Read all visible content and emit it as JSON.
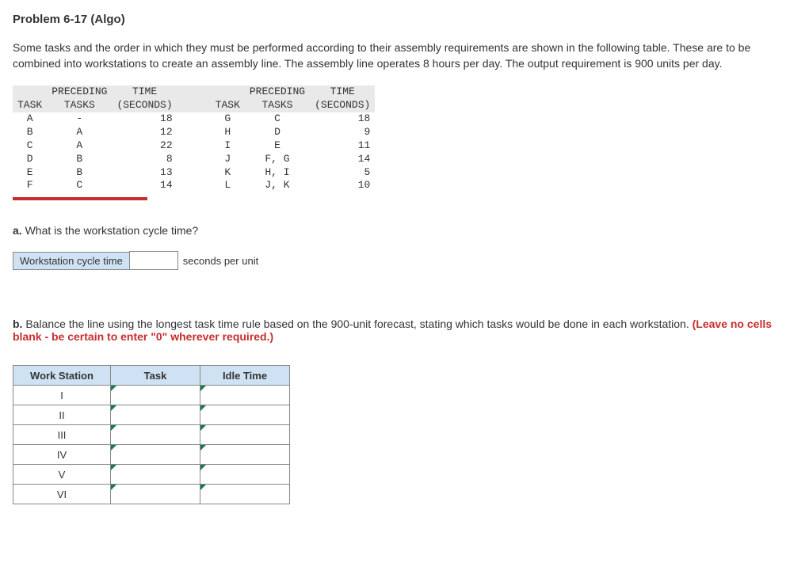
{
  "title": "Problem 6-17 (Algo)",
  "intro": "Some tasks and the order in which they must be performed according to their assembly requirements are shown in the following table. These are to be combined into workstations to create an assembly line. The assembly line operates 8 hours per day. The output requirement is 900 units per day.",
  "headers": {
    "task": "TASK",
    "preceding1": "PRECEDING",
    "preceding2": "TASKS",
    "time1": "TIME",
    "time2": "(SECONDS)"
  },
  "left_rows": [
    {
      "task": "A",
      "prec": "-",
      "time": "18"
    },
    {
      "task": "B",
      "prec": "A",
      "time": "12"
    },
    {
      "task": "C",
      "prec": "A",
      "time": "22"
    },
    {
      "task": "D",
      "prec": "B",
      "time": "8"
    },
    {
      "task": "E",
      "prec": "B",
      "time": "13"
    },
    {
      "task": "F",
      "prec": "C",
      "time": "14"
    }
  ],
  "right_rows": [
    {
      "task": "G",
      "prec": "C",
      "time": "18"
    },
    {
      "task": "H",
      "prec": "D",
      "time": "9"
    },
    {
      "task": "I",
      "prec": "E",
      "time": "11"
    },
    {
      "task": "J",
      "prec": "F, G",
      "time": "14"
    },
    {
      "task": "K",
      "prec": "H, I",
      "time": "5"
    },
    {
      "task": "L",
      "prec": "J, K",
      "time": "10"
    }
  ],
  "part_a": {
    "prefix": "a.",
    "text": " What is the workstation cycle time?",
    "label": "Workstation cycle time",
    "unit": "seconds per unit"
  },
  "part_b": {
    "prefix": "b.",
    "text": " Balance the line using the longest task time rule based on the 900-unit forecast, stating which tasks would be done in each workstation. ",
    "warn": "(Leave no cells blank - be certain to enter \"0\" wherever required.)"
  },
  "ws_headers": {
    "ws": "Work Station",
    "task": "Task",
    "idle": "Idle Time"
  },
  "ws_rows": [
    "I",
    "II",
    "III",
    "IV",
    "V",
    "VI"
  ]
}
